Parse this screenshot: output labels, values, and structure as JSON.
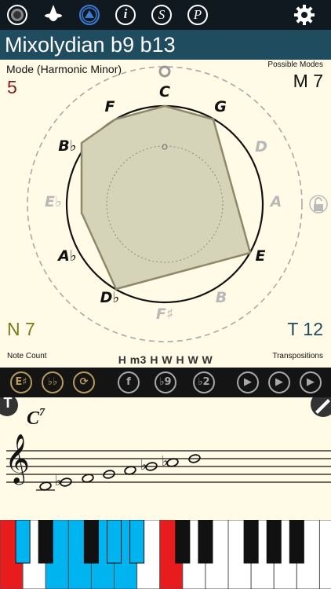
{
  "topbar": {
    "icons": [
      "record-icon",
      "wizard-icon",
      "mode-triangle-icon",
      "info-icon",
      "s-icon",
      "p-icon",
      "gear-icon"
    ],
    "info_glyph": "i",
    "s_glyph": "S",
    "p_glyph": "P"
  },
  "title": "Mixolydian b9 b13",
  "mode_label": "Mode (Harmonic Minor)",
  "mode_number": "5",
  "possible_modes_label": "Possible Modes",
  "possible_modes_value": "M 7",
  "note_count_value": "N 7",
  "note_count_label": "Note Count",
  "transpositions_value": "T 12",
  "transpositions_label": "Transpositions",
  "intervals": "H m3 H W H W W",
  "circle_notes": [
    {
      "name": "C",
      "active": true
    },
    {
      "name": "G",
      "active": true
    },
    {
      "name": "D",
      "active": false
    },
    {
      "name": "A",
      "active": false
    },
    {
      "name": "E",
      "active": true
    },
    {
      "name": "B",
      "active": false
    },
    {
      "name": "F♯",
      "active": false
    },
    {
      "name": "D♭",
      "active": true
    },
    {
      "name": "A♭",
      "active": true
    },
    {
      "name": "E♭",
      "active": false
    },
    {
      "name": "B♭",
      "active": true
    },
    {
      "name": "F",
      "active": true
    }
  ],
  "controls": [
    {
      "name": "e-sharp-button",
      "glyph": "E♯"
    },
    {
      "name": "double-flat-button",
      "glyph": "♭♭"
    },
    {
      "name": "cycle-button",
      "glyph": "⟳"
    },
    {
      "name": "function-button",
      "glyph": "f"
    },
    {
      "name": "flat9-button",
      "glyph": "♭9"
    },
    {
      "name": "flat2-button",
      "glyph": "♭2"
    },
    {
      "name": "play-chord-button",
      "glyph": "▶"
    },
    {
      "name": "play-up-button",
      "glyph": "▶"
    },
    {
      "name": "play-scale-button",
      "glyph": "▶"
    }
  ],
  "chord_symbol": "C",
  "chord_superscript": "7",
  "t_badge": "T",
  "colors": {
    "active_note": "#111111",
    "inactive_note": "#b8b8b8",
    "polygon_fill": "#d6d4b8",
    "polygon_stroke": "#8b8a6a",
    "mode_number": "#8b1a1a",
    "olive": "#7a7a1a",
    "teal": "#1f4c5e",
    "key_red": "#e81c1c",
    "key_cyan": "#00b4ef"
  }
}
